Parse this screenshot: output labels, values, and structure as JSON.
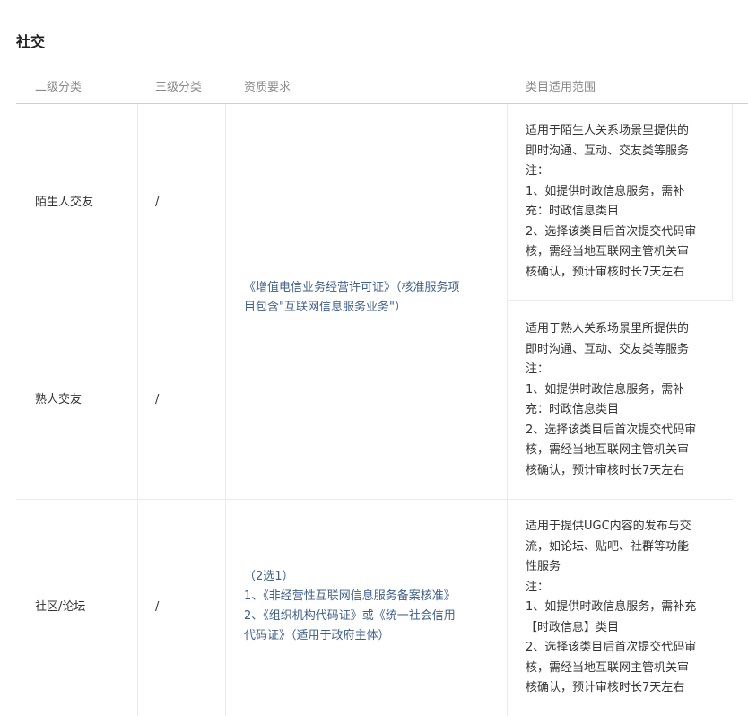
{
  "section_title": "社交",
  "headers": [
    "二级分类",
    "三级分类",
    "资质要求",
    "类目适用范围"
  ],
  "rows": [
    {
      "level2": "陌生人交友",
      "level3": "/",
      "scope_lines": [
        "适用于陌生人关系场景里提供的",
        "即时沟通、互动、交友类等服务",
        "注：",
        "1、如提供时政信息服务，需补",
        "充：时政信息类目",
        "2、选择该类目后首次提交代码审",
        "核，需经当地互联网主管机关审",
        "核确认，预计审核时长7天左右"
      ]
    },
    {
      "level2": "熟人交友",
      "level3": "/",
      "scope_lines": [
        "适用于熟人关系场景里所提供的",
        "即时沟通、互动、交友类等服务",
        "注：",
        "1、如提供时政信息服务，需补",
        "充：时政信息类目",
        "2、选择该类目后首次提交代码审",
        "核，需经当地互联网主管机关审",
        "核确认，预计审核时长7天左右"
      ]
    },
    {
      "level2": "社区/论坛",
      "level3": "/",
      "scope_lines": [
        "适用于提供UGC内容的发布与交",
        "流，如论坛、贴吧、社群等功能",
        "性服务",
        "注：",
        "1、如提供时政信息服务，需补充",
        "【时政信息】类目",
        "2、选择该类目后首次提交代码审",
        "核，需经当地互联网主管机关审",
        "核确认，预计审核时长7天左右"
      ]
    }
  ],
  "qualification_shared_lines": [
    "《增值电信业务经营许可证》（核准服务项",
    "目包含\"互联网信息服务业务\"）"
  ],
  "qualification_community_lines": [
    "（2选1）",
    "1、《非经营性互联网信息服务备案核准》",
    "2、《组织机构代码证》或《统一社会信用",
    "代码证》（适用于政府主体）"
  ]
}
